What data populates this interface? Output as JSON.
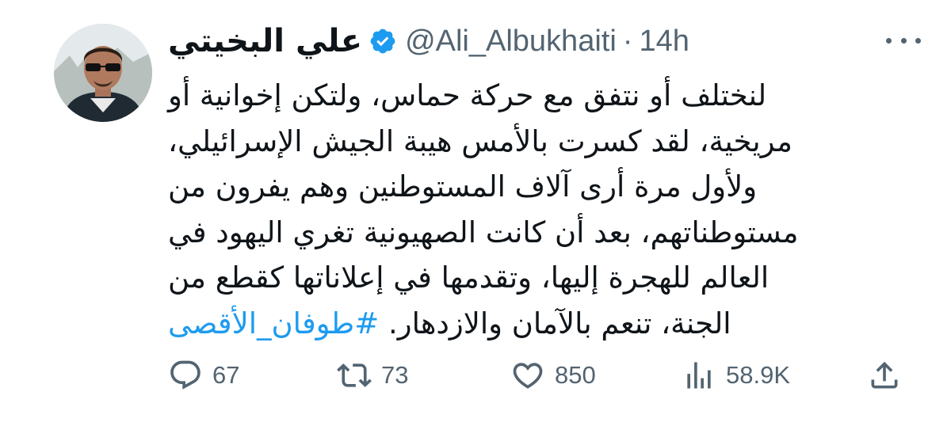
{
  "tweet": {
    "display_name": "علي البخيتي",
    "handle": "@Ali_Albukhaiti",
    "separator": "·",
    "timestamp": "14h",
    "text_lines": [
      "لنختلف أو نتفق مع حركة حماس، ولتكن إخوانية أو",
      "مريخية، لقد كسرت بالأمس هيبة الجيش الإسرائيلي،",
      "ولأول مرة أرى آلاف المستوطنين وهم يفرون من",
      "مستوطناتهم، بعد أن كانت الصهيونية تغري اليهود في",
      "العالم للهجرة إليها، وتقدمها في إعلاناتها كقطع من",
      "الجنة، تنعم بالآمان والازدهار."
    ],
    "hashtag": "#طوفان_الأقصى"
  },
  "actions": {
    "replies": "67",
    "retweets": "73",
    "likes": "850",
    "views": "58.9K"
  },
  "icons": {
    "verified": "verified-badge-icon",
    "more": "more-options-icon",
    "reply": "reply-icon",
    "retweet": "retweet-icon",
    "like": "like-icon",
    "views": "views-icon",
    "share": "share-icon"
  },
  "colors": {
    "verified_blue": "#1d9bf0",
    "hashtag": "#1d9bf0",
    "secondary_text": "#536471",
    "primary_text": "#0f1419"
  }
}
